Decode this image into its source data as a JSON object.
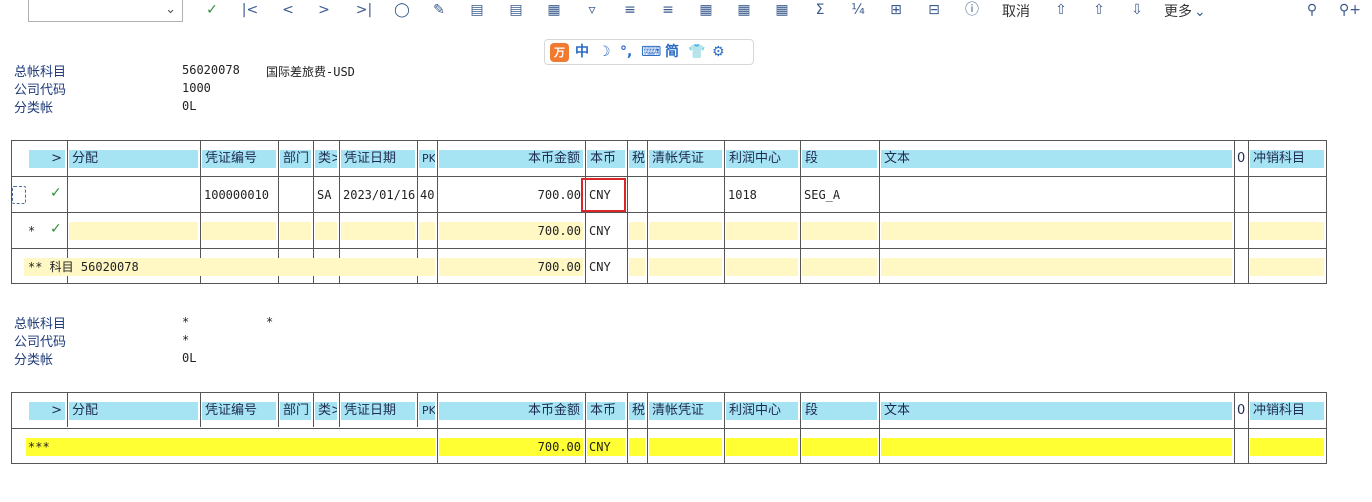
{
  "toolbar": {
    "select_value": "",
    "cancel_label": "取消",
    "more_label": "更多"
  },
  "ime": {
    "logo": "万",
    "items": [
      "中",
      "☽",
      "°,",
      "⌨",
      "简",
      "👕",
      "⚙"
    ]
  },
  "section1": {
    "labels": [
      "总帐科目",
      "公司代码",
      "分类帐"
    ],
    "gl_account": "56020078",
    "gl_account_desc": "国际差旅费-USD",
    "company_code": "1000",
    "ledger": "0L"
  },
  "section2": {
    "labels": [
      "总帐科目",
      "公司代码",
      "分类帐"
    ],
    "gl_account": "*",
    "gl_account_desc": "*",
    "company_code": "*",
    "ledger": "0L"
  },
  "columns": {
    "expand": ">",
    "assignment": "分配",
    "doc_no": "凭证编号",
    "dept": "部门",
    "type": "类>",
    "doc_date": "凭证日期",
    "pk": "PK",
    "amount": "本币金额",
    "currency": "本币",
    "tax": "税",
    "clearing_doc": "清帐凭证",
    "profit_center": "利润中心",
    "segment": "段",
    "text": "文本",
    "zero": "0",
    "offset_account": "冲销科目"
  },
  "table1": {
    "row1": {
      "doc_no": "100000010",
      "type": "SA",
      "doc_date": "2023/01/16",
      "pk": "40",
      "amount": "700.00",
      "currency": "CNY",
      "profit_center": "1018",
      "segment": "SEG_A"
    },
    "row2": {
      "marker": "*",
      "amount": "700.00",
      "currency": "CNY"
    },
    "row3": {
      "label": "** 科目 56020078",
      "amount": "700.00",
      "currency": "CNY"
    }
  },
  "table2": {
    "row1": {
      "marker": "***",
      "amount": "700.00",
      "currency": "CNY"
    }
  },
  "colors": {
    "header_bg": "#a7e4f3",
    "subtotal_bg": "#fff8c4",
    "total_bg": "#ffff33",
    "highlight_border": "#d8262a",
    "check": "#2f8f3b"
  }
}
